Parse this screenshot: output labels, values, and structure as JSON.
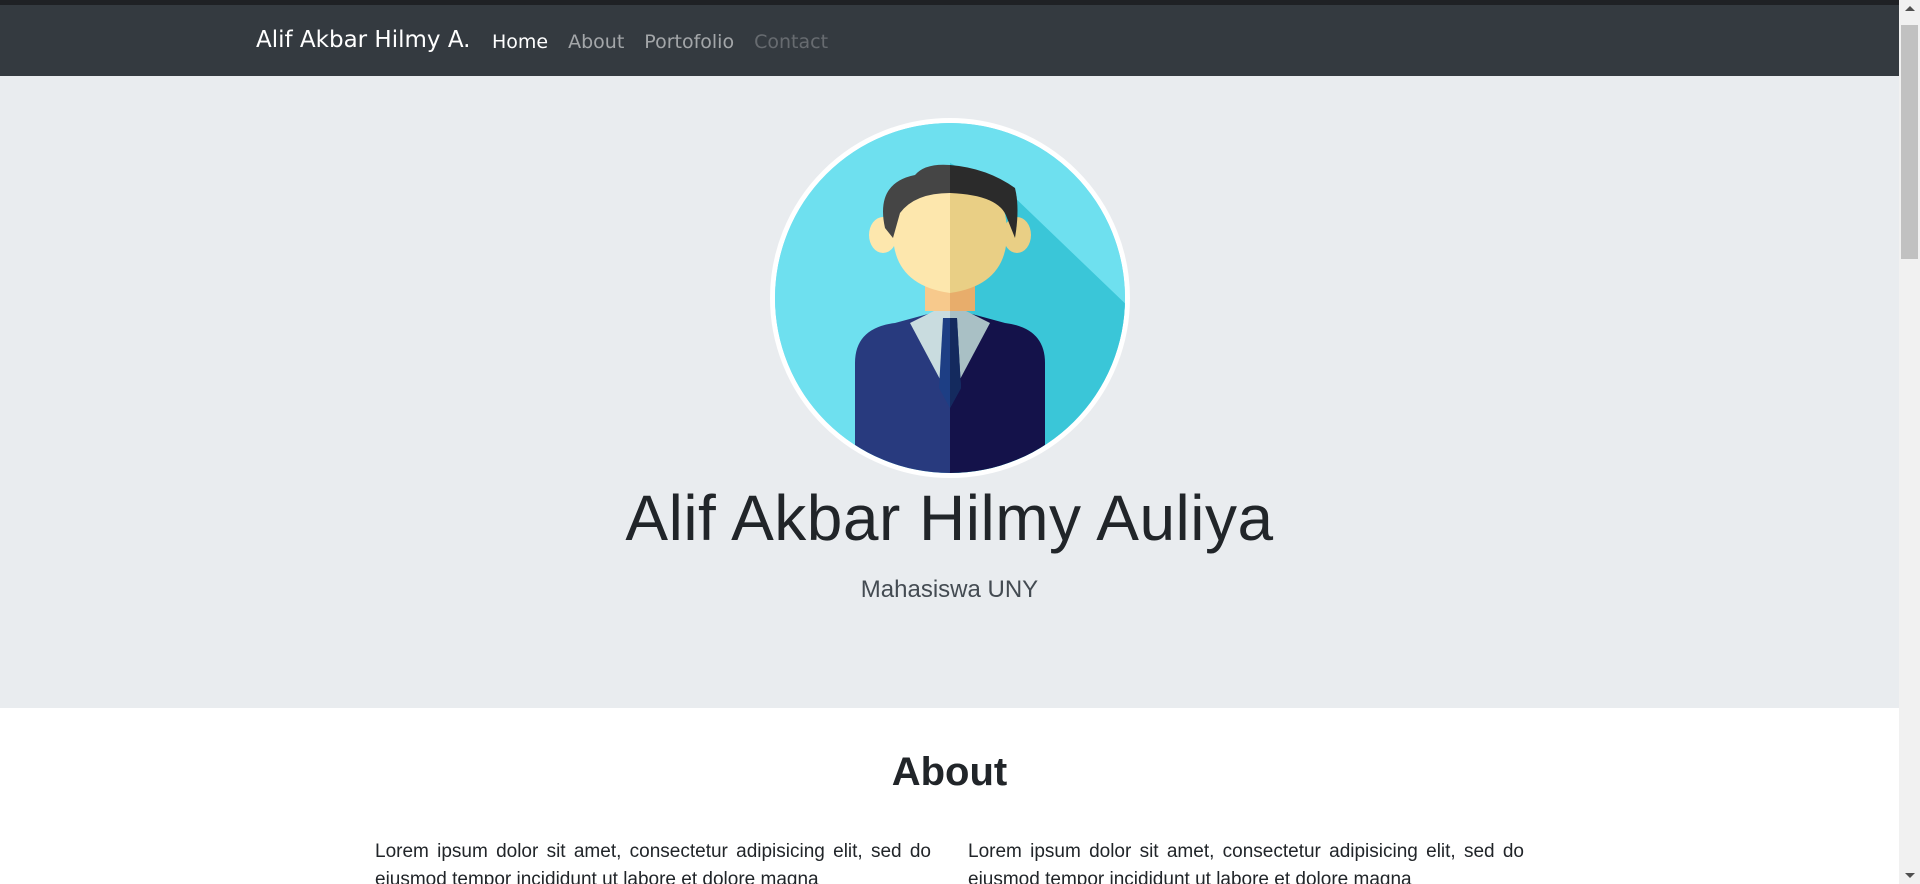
{
  "navbar": {
    "brand": "Alif Akbar Hilmy A.",
    "links": [
      {
        "label": "Home",
        "state": "active"
      },
      {
        "label": "About",
        "state": "normal"
      },
      {
        "label": "Portofolio",
        "state": "normal"
      },
      {
        "label": "Contact",
        "state": "disabled"
      }
    ]
  },
  "hero": {
    "avatar_icon": "businessman-avatar-icon",
    "name": "Alif Akbar Hilmy Auliya",
    "subtitle": "Mahasiswa UNY"
  },
  "about": {
    "title": "About",
    "left_paragraph": "Lorem ipsum dolor sit amet, consectetur adipisicing elit, sed do eiusmod tempor incididunt ut labore et dolore magna",
    "right_paragraph": "Lorem ipsum dolor sit amet, consectetur adipisicing elit, sed do eiusmod tempor incididunt ut labore et dolore magna"
  },
  "colors": {
    "navbar_bg": "#343a40",
    "jumbotron_bg": "#e9ecef",
    "avatar_bg": "#6ee0ef"
  }
}
